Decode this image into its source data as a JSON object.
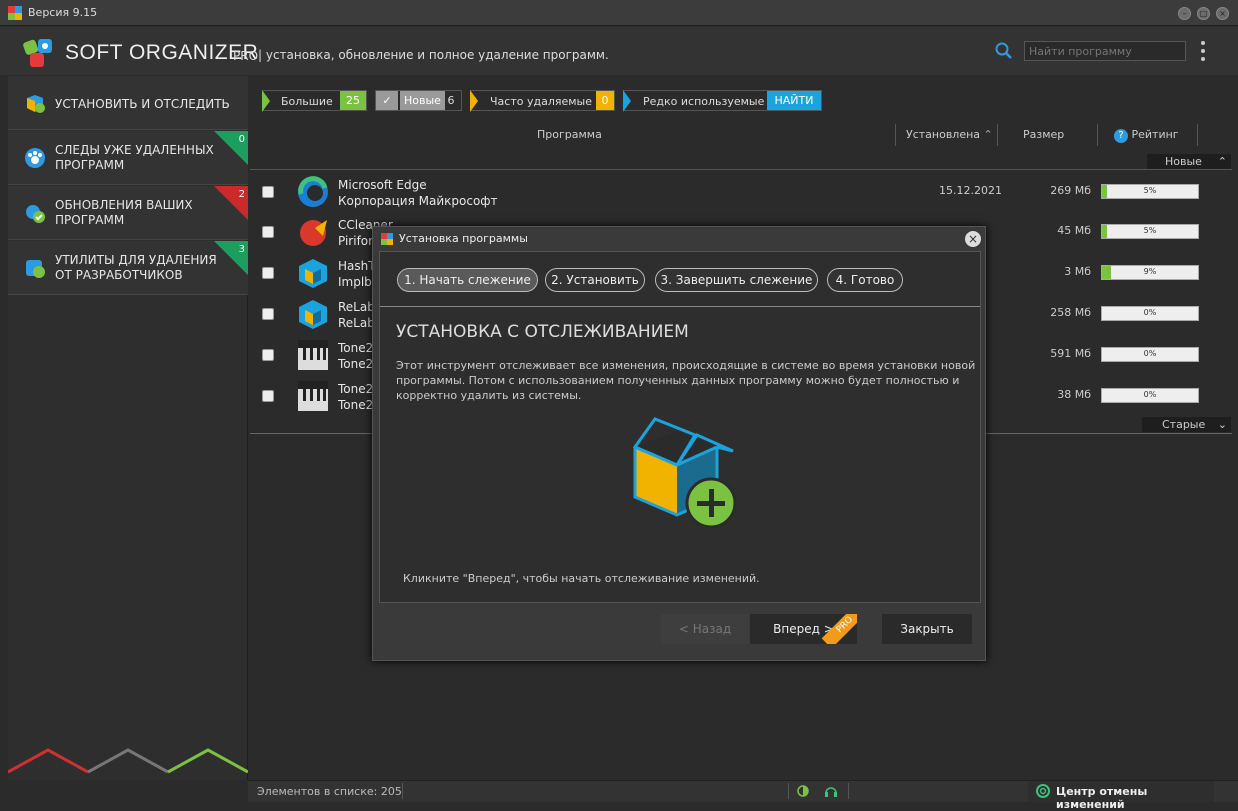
{
  "window": {
    "version": "Версия 9.15"
  },
  "header": {
    "brand": "SOFT ORGANIZER",
    "pro": "PRO",
    "slogan": "| установка, обновление и полное удаление программ.",
    "search_placeholder": "Найти программу"
  },
  "sidebar": {
    "items": [
      {
        "label": "УСТАНОВИТЬ И ОТСЛЕДИТЬ"
      },
      {
        "label1": "СЛЕДЫ УЖЕ УДАЛЕННЫХ",
        "label2": "ПРОГРАММ",
        "badge": "0",
        "badge_color": "#1e9e5e"
      },
      {
        "label1": "ОБНОВЛЕНИЯ ВАШИХ",
        "label2": "ПРОГРАММ",
        "badge": "2",
        "badge_color": "#cc2a2a"
      },
      {
        "label1": "УТИЛИТЫ ДЛЯ УДАЛЕНИЯ",
        "label2": "ОТ РАЗРАБОТЧИКОВ",
        "badge": "3",
        "badge_color": "#1e9e5e"
      }
    ]
  },
  "filters": [
    {
      "label": "Большие",
      "count": "25",
      "color": "#7cc242"
    },
    {
      "label": "Новые",
      "count": "6",
      "color": "#9a9a9a"
    },
    {
      "label": "Часто удаляемые",
      "count": "0",
      "color": "#f2b200"
    },
    {
      "label": "Редко используемые",
      "count": "НАЙТИ",
      "color": "#1aa3dd"
    }
  ],
  "columns": {
    "program": "Программа",
    "installed": "Установлена",
    "size": "Размер",
    "rating": "Рейтинг"
  },
  "groups": {
    "new": "Новые",
    "old": "Старые"
  },
  "rows": [
    {
      "name": "Microsoft Edge",
      "vendor": "Корпорация Майкрософт",
      "date": "15.12.2021",
      "size": "269 Мб",
      "rating": "5%",
      "rating_value": 0.05
    },
    {
      "name": "CCleaner",
      "vendor": "Piriform",
      "date": "",
      "size": "45 Мб",
      "rating": "5%",
      "rating_value": 0.05
    },
    {
      "name": "HashTab",
      "vendor": "Implbits",
      "date": "",
      "size": "3 Мб",
      "rating": "9%",
      "rating_value": 0.09
    },
    {
      "name": "ReLab",
      "vendor": "ReLab",
      "date": "",
      "size": "258 Мб",
      "rating": "0%",
      "rating_value": 0
    },
    {
      "name": "Tone2",
      "vendor": "Tone2",
      "date": "",
      "size": "591 Мб",
      "rating": "0%",
      "rating_value": 0
    },
    {
      "name": "Tone2",
      "vendor": "Tone2",
      "date": "",
      "size": "38 Мб",
      "rating": "0%",
      "rating_value": 0
    }
  ],
  "dialog": {
    "title": "Установка программы",
    "steps": [
      "1. Начать слежение",
      "2. Установить",
      "3. Завершить слежение",
      "4. Готово"
    ],
    "heading": "УСТАНОВКА С ОТСЛЕЖИВАНИЕМ",
    "desc1": "Этот инструмент отслеживает все изменения, происходящие в системе во время установки новой",
    "desc2": "программы. Потом с использованием полученных данных программу можно будет полностью и",
    "desc3": "корректно удалить из системы.",
    "hint": "Кликните \"Вперед\", чтобы начать отслеживание изменений.",
    "back": "< Назад",
    "next": "Вперед >",
    "next_badge": "PRO",
    "close": "Закрыть"
  },
  "status": {
    "count": "Элементов в списке: 205",
    "undo_center": "Центр отмены изменений"
  }
}
